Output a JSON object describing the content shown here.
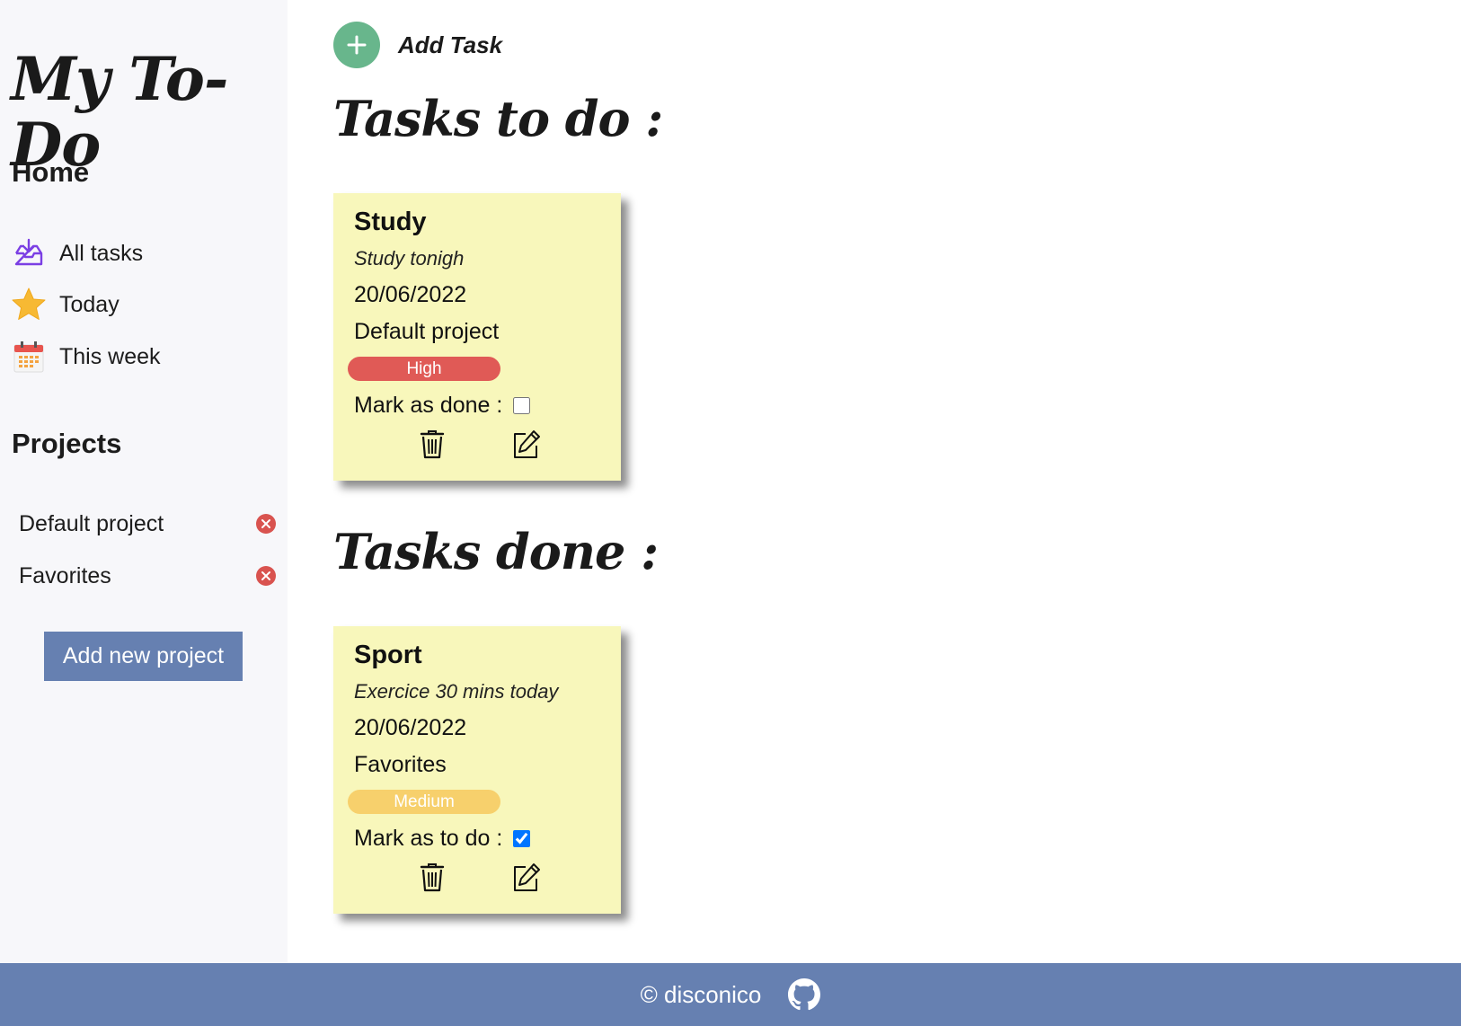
{
  "sidebar": {
    "logo": "My To-Do",
    "home_title": "Home",
    "nav": [
      {
        "label": "All tasks",
        "icon": "inbox-download-icon"
      },
      {
        "label": "Today",
        "icon": "star-icon"
      },
      {
        "label": "This week",
        "icon": "calendar-icon"
      }
    ],
    "projects_title": "Projects",
    "projects": [
      {
        "label": "Default project",
        "delete_icon": "close-circle-icon"
      },
      {
        "label": "Favorites",
        "delete_icon": "close-circle-icon"
      }
    ],
    "add_project_label": "Add new project"
  },
  "main": {
    "add_task_label": "Add Task",
    "todo_title": "Tasks to do :",
    "done_title": "Tasks done :",
    "todo_tasks": [
      {
        "title": "Study",
        "description": "Study tonigh",
        "date": "20/06/2022",
        "project": "Default project",
        "priority": "High",
        "priority_color": "#e05a56",
        "mark_label": "Mark as done :",
        "checked": false
      }
    ],
    "done_tasks": [
      {
        "title": "Sport",
        "description": "Exercice 30 mins today",
        "date": "20/06/2022",
        "project": "Favorites",
        "priority": "Medium",
        "priority_color": "#f7d06c",
        "mark_label": "Mark as to do :",
        "checked": true
      }
    ]
  },
  "footer": {
    "credit": "© disconico",
    "icon": "github-icon"
  },
  "colors": {
    "accent": "#6680b1",
    "add_button": "#68b68c",
    "card_bg": "#f8f7bb",
    "delete_red": "#d9534f"
  }
}
